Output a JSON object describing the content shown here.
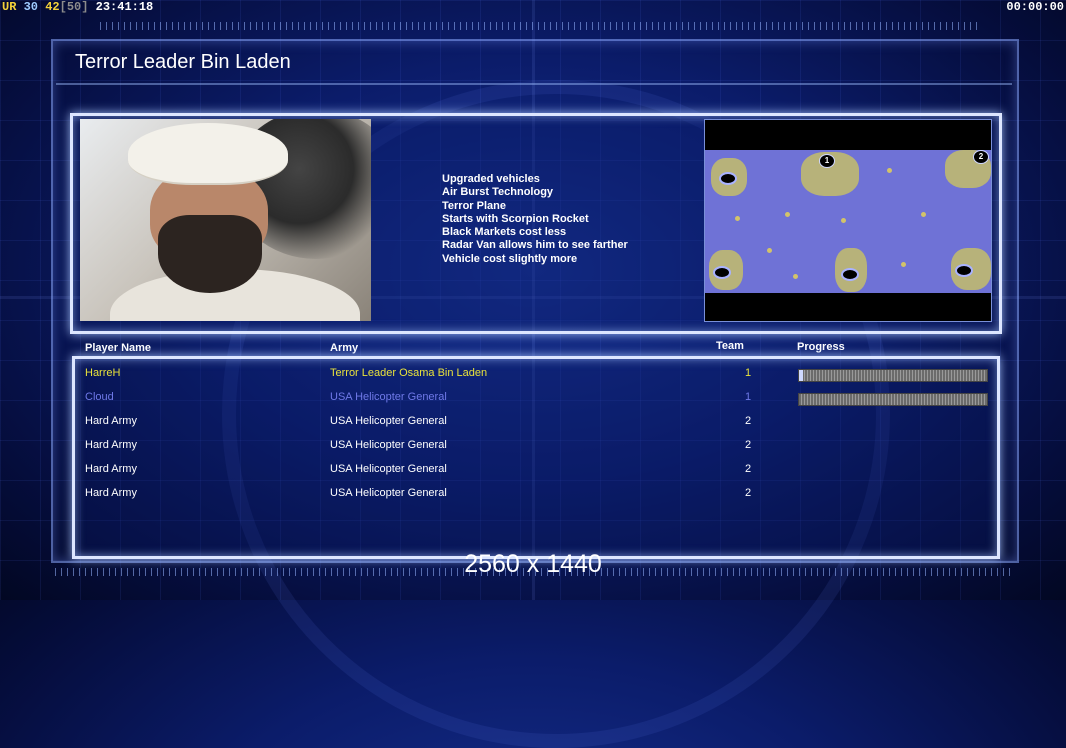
{
  "hud": {
    "ur": "UR",
    "v1": "30",
    "v2": "42",
    "v3": "[50]",
    "clock": "23:41:18",
    "timer": "00:00:00"
  },
  "title": "Terror Leader Bin Laden",
  "traits": [
    "Upgraded vehicles",
    "Air Burst Technology",
    "Terror Plane",
    "Starts with Scorpion Rocket",
    "Black Markets cost less",
    "Radar Van allows him to see farther",
    "Vehicle cost slightly more"
  ],
  "minimap": {
    "badges": [
      "1",
      "2"
    ]
  },
  "table": {
    "headers": {
      "name": "Player Name",
      "army": "Army",
      "team": "Team",
      "progress": "Progress"
    },
    "rows": [
      {
        "name": "HarreH",
        "army": "Terror Leader Osama Bin Laden",
        "team": "1",
        "color": "#e9e23b",
        "progress": 0.02
      },
      {
        "name": "Cloud",
        "army": "USA Helicopter General",
        "team": "1",
        "color": "#6f79e8",
        "progress": 0.0
      },
      {
        "name": "Hard Army",
        "army": "USA Helicopter General",
        "team": "2",
        "color": "#ffffff"
      },
      {
        "name": "Hard Army",
        "army": "USA Helicopter General",
        "team": "2",
        "color": "#ffffff"
      },
      {
        "name": "Hard Army",
        "army": "USA Helicopter General",
        "team": "2",
        "color": "#ffffff"
      },
      {
        "name": "Hard Army",
        "army": "USA Helicopter General",
        "team": "2",
        "color": "#ffffff"
      }
    ]
  },
  "resolution": "2560 x 1440"
}
